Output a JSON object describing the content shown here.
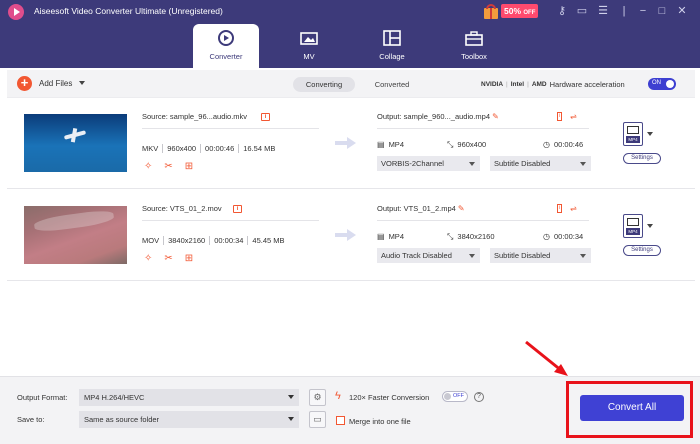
{
  "window": {
    "title": "Aiseesoft Video Converter Ultimate (Unregistered)",
    "promo_text": "50%",
    "promo_suffix": "OFF"
  },
  "nav_tabs": [
    {
      "label": "Converter",
      "active": true,
      "icon": "converter-icon"
    },
    {
      "label": "MV",
      "active": false,
      "icon": "mv-icon"
    },
    {
      "label": "Collage",
      "active": false,
      "icon": "collage-icon"
    },
    {
      "label": "Toolbox",
      "active": false,
      "icon": "toolbox-icon"
    }
  ],
  "toolbar": {
    "add_files": "Add Files",
    "seg_converting": "Converting",
    "seg_converted": "Converted",
    "brands": [
      "NVIDIA",
      "Intel",
      "AMD"
    ],
    "hw_label": "Hardware acceleration",
    "hw_toggle": "ON"
  },
  "files": [
    {
      "source": "Source: sample_96...audio.mkv",
      "format": "MKV",
      "resolution": "960x400",
      "duration": "00:00:46",
      "size": "16.54 MB",
      "output_name": "Output: sample_960..._audio.mp4",
      "out_format": "MP4",
      "out_resolution": "960x400",
      "out_duration": "00:00:46",
      "audio_track": "VORBIS-2Channel",
      "subtitle": "Subtitle Disabled",
      "format_badge": "MP4",
      "settings_label": "Settings"
    },
    {
      "source": "Source: VTS_01_2.mov",
      "format": "MOV",
      "resolution": "3840x2160",
      "duration": "00:00:34",
      "size": "45.45 MB",
      "output_name": "Output: VTS_01_2.mp4",
      "out_format": "MP4",
      "out_resolution": "3840x2160",
      "out_duration": "00:00:34",
      "audio_track": "Audio Track Disabled",
      "subtitle": "Subtitle Disabled",
      "format_badge": "MP4",
      "settings_label": "Settings"
    }
  ],
  "bottom": {
    "output_format_label": "Output Format:",
    "output_format_value": "MP4 H.264/HEVC",
    "save_to_label": "Save to:",
    "save_to_value": "Same as source folder",
    "faster_label": "120× Faster Conversion",
    "faster_toggle": "OFF",
    "merge_label": "Merge into one file",
    "convert_all": "Convert All"
  },
  "colors": {
    "titlebar": "#3d3a7a",
    "accent": "#f25732",
    "primary_button": "#3f41d4",
    "highlight": "#e8121a"
  }
}
